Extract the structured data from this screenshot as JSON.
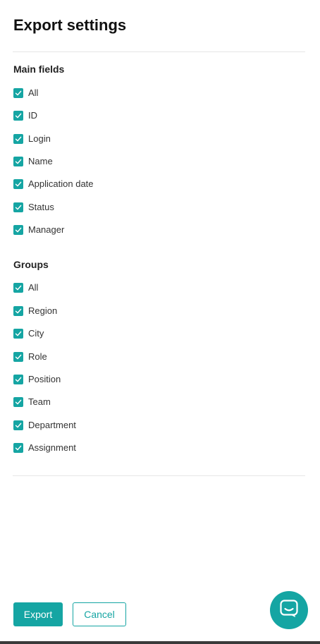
{
  "title": "Export settings",
  "colors": {
    "accent": "#15a5a3",
    "divider": "#e6e6e6"
  },
  "main_fields": {
    "heading": "Main fields",
    "options": [
      {
        "label": "All",
        "checked": true
      },
      {
        "label": "ID",
        "checked": true
      },
      {
        "label": "Login",
        "checked": true
      },
      {
        "label": "Name",
        "checked": true
      },
      {
        "label": "Application date",
        "checked": true
      },
      {
        "label": "Status",
        "checked": true
      },
      {
        "label": "Manager",
        "checked": true
      }
    ]
  },
  "groups": {
    "heading": "Groups",
    "options": [
      {
        "label": "All",
        "checked": true
      },
      {
        "label": "Region",
        "checked": true
      },
      {
        "label": "City",
        "checked": true
      },
      {
        "label": "Role",
        "checked": true
      },
      {
        "label": "Position",
        "checked": true
      },
      {
        "label": "Team",
        "checked": true
      },
      {
        "label": "Department",
        "checked": true
      },
      {
        "label": "Assignment",
        "checked": true
      }
    ]
  },
  "footer": {
    "export_label": "Export",
    "cancel_label": "Cancel"
  },
  "chat_widget": {
    "icon": "chat-icon"
  }
}
